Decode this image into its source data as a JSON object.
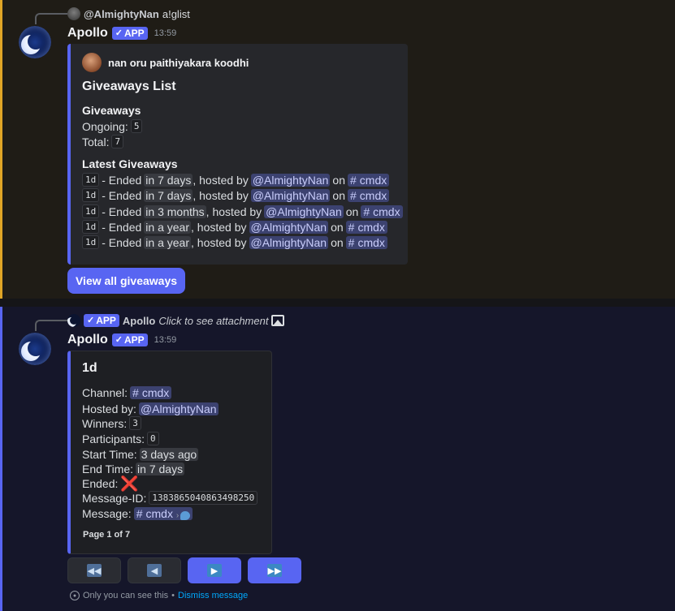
{
  "message1": {
    "reply": {
      "user": "@AlmightyNan",
      "command": "a!glist"
    },
    "bot_name": "Apollo",
    "app_tag": "APP",
    "timestamp": "13:59",
    "embed": {
      "author": "nan oru paithiyakara koodhi",
      "title": "Giveaways List",
      "giveaways_heading": "Giveaways",
      "ongoing_label": "Ongoing:",
      "ongoing_value": "5",
      "total_label": "Total:",
      "total_value": "7",
      "latest_heading": "Latest Giveaways",
      "items": [
        {
          "prize": "1d",
          "ended": "- Ended",
          "when": "in 7 days",
          "hosted": ", hosted by",
          "host": "@AlmightyNan",
          "on": "on",
          "channel": "cmdx"
        },
        {
          "prize": "1d",
          "ended": "- Ended",
          "when": "in 7 days",
          "hosted": ", hosted by",
          "host": "@AlmightyNan",
          "on": "on",
          "channel": "cmdx"
        },
        {
          "prize": "1d",
          "ended": "- Ended",
          "when": "in 3 months",
          "hosted": ", hosted by",
          "host": "@AlmightyNan",
          "on": "on",
          "channel": "cmdx"
        },
        {
          "prize": "1d",
          "ended": "- Ended",
          "when": "in a year",
          "hosted": ", hosted by",
          "host": "@AlmightyNan",
          "on": "on",
          "channel": "cmdx"
        },
        {
          "prize": "1d",
          "ended": "- Ended",
          "when": "in a year",
          "hosted": ", hosted by",
          "host": "@AlmightyNan",
          "on": "on",
          "channel": "cmdx"
        }
      ]
    },
    "button_label": "View all giveaways"
  },
  "message2": {
    "reply": {
      "app_tag": "APP",
      "bot_name": "Apollo",
      "text": "Click to see attachment"
    },
    "bot_name": "Apollo",
    "app_tag": "APP",
    "timestamp": "13:59",
    "embed": {
      "title": "1d",
      "channel_label": "Channel:",
      "channel_value": "cmdx",
      "hosted_label": "Hosted by:",
      "hosted_value": "@AlmightyNan",
      "winners_label": "Winners:",
      "winners_value": "3",
      "participants_label": "Participants:",
      "participants_value": "0",
      "start_label": "Start Time:",
      "start_value": "3 days ago",
      "end_label": "End Time:",
      "end_value": "in 7 days",
      "ended_label": "Ended:",
      "ended_value": "❌",
      "message_id_label": "Message-ID:",
      "message_id_value": "1383865040863498250",
      "message_label": "Message:",
      "message_value": "cmdx",
      "footer": "Page 1 of 7"
    },
    "nav_buttons": [
      "first-page",
      "previous-page",
      "next-page",
      "last-page"
    ],
    "ephemeral_note": "Only you can see this",
    "ephemeral_sep": "•",
    "dismiss_label": "Dismiss message"
  },
  "colors": {
    "blurple": "#5865f2",
    "mention_bg": "#3c4270",
    "highlight_border": "#e0a526"
  }
}
